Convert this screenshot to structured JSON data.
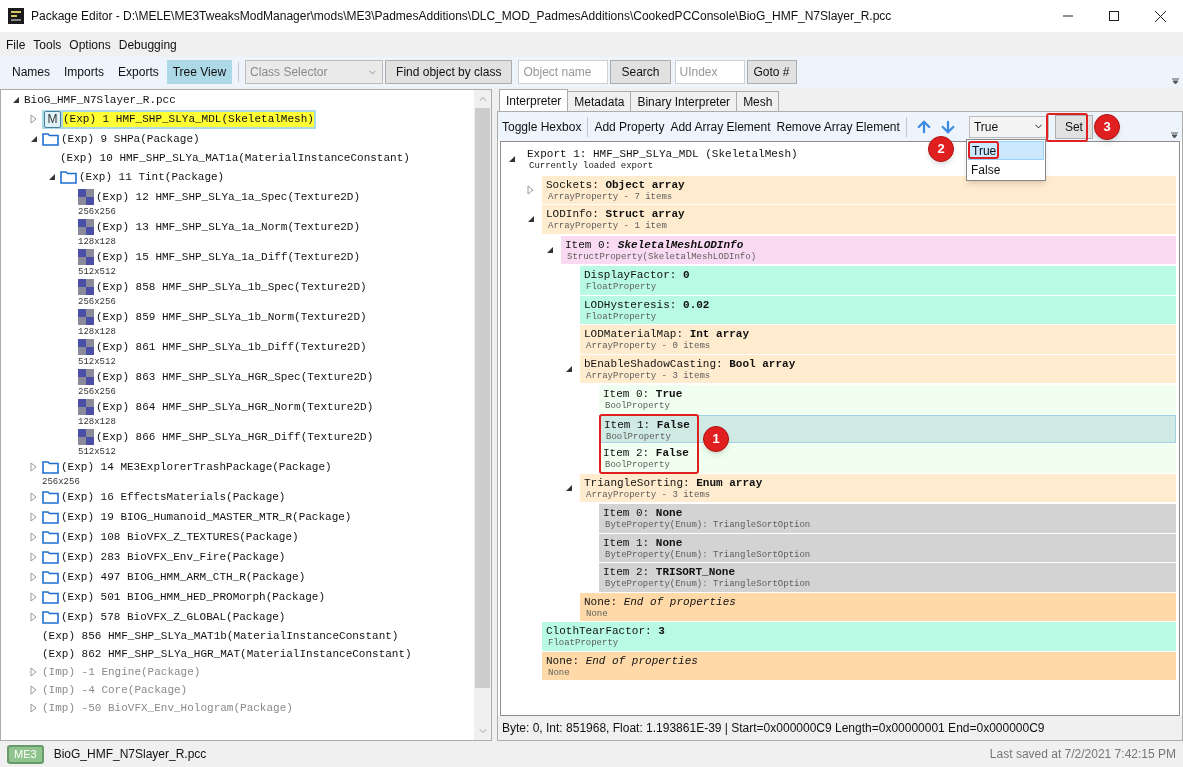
{
  "window": {
    "title": "Package Editor - D:\\MELE\\ME3TweaksModManager\\mods\\ME3\\PadmesAdditions\\DLC_MOD_PadmesAdditions\\CookedPCConsole\\BioG_HMF_N7Slayer_R.pcc"
  },
  "menu": [
    "File",
    "Tools",
    "Options",
    "Debugging"
  ],
  "view_buttons": [
    {
      "label": "Names",
      "selected": false
    },
    {
      "label": "Imports",
      "selected": false
    },
    {
      "label": "Exports",
      "selected": false
    },
    {
      "label": "Tree View",
      "selected": true
    }
  ],
  "class_selector": {
    "placeholder": "Class Selector",
    "disabled": true
  },
  "find_button": "Find object by class",
  "object_name": {
    "placeholder": "Object name"
  },
  "search_button": "Search",
  "uindex": {
    "placeholder": "UIndex"
  },
  "goto_button": "Goto #",
  "tree": {
    "text": "BioG_HMF_N7Slayer_R.pcc",
    "expanded": true,
    "selected": false,
    "children": [
      {
        "kind": "mesh",
        "badge": "M",
        "text": "(Exp) 1 HMF_SHP_SLYa_MDL(SkeletalMesh)",
        "expanded": false,
        "selected": true,
        "imported": false
      },
      {
        "kind": "folder",
        "text": "(Exp) 9 SHPa(Package)",
        "expanded": true,
        "selected": false,
        "imported": false,
        "children": [
          {
            "kind": "plain",
            "text": "(Exp) 10 HMF_SHP_SLYa_MAT1a(MaterialInstanceConstant)",
            "selected": false
          },
          {
            "kind": "folder",
            "text": "(Exp) 11 Tint(Package)",
            "expanded": true,
            "selected": false,
            "children": [
              {
                "kind": "texture",
                "text": "(Exp) 12 HMF_SHP_SLYa_1a_Spec(Texture2D)",
                "dims": "256x256",
                "selected": false
              },
              {
                "kind": "texture",
                "text": "(Exp) 13 HMF_SHP_SLYa_1a_Norm(Texture2D)",
                "dims": "128x128",
                "selected": false
              },
              {
                "kind": "texture",
                "text": "(Exp) 15 HMF_SHP_SLYa_1a_Diff(Texture2D)",
                "dims": "512x512",
                "selected": false
              },
              {
                "kind": "texture",
                "text": "(Exp) 858 HMF_SHP_SLYa_1b_Spec(Texture2D)",
                "dims": "256x256",
                "selected": false
              },
              {
                "kind": "texture",
                "text": "(Exp) 859 HMF_SHP_SLYa_1b_Norm(Texture2D)",
                "dims": "128x128",
                "selected": false
              },
              {
                "kind": "texture",
                "text": "(Exp) 861 HMF_SHP_SLYa_1b_Diff(Texture2D)",
                "dims": "512x512",
                "selected": false
              },
              {
                "kind": "texture",
                "text": "(Exp) 863 HMF_SHP_SLYa_HGR_Spec(Texture2D)",
                "dims": "256x256",
                "selected": false
              },
              {
                "kind": "texture",
                "text": "(Exp) 864 HMF_SHP_SLYa_HGR_Norm(Texture2D)",
                "dims": "128x128",
                "selected": false
              },
              {
                "kind": "texture",
                "text": "(Exp) 866 HMF_SHP_SLYa_HGR_Diff(Texture2D)",
                "dims": "512x512",
                "selected": false
              }
            ]
          }
        ]
      },
      {
        "kind": "folder",
        "text": "(Exp) 14 ME3ExplorerTrashPackage(Package)",
        "dims": "256x256",
        "expanded": false,
        "selected": false,
        "imported": false
      },
      {
        "kind": "folder",
        "text": "(Exp) 16 EffectsMaterials(Package)",
        "expanded": false,
        "selected": false,
        "imported": false
      },
      {
        "kind": "folder",
        "text": "(Exp) 19 BIOG_Humanoid_MASTER_MTR_R(Package)",
        "expanded": false,
        "selected": false,
        "imported": false
      },
      {
        "kind": "folder",
        "text": "(Exp) 108 BioVFX_Z_TEXTURES(Package)",
        "expanded": false,
        "selected": false,
        "imported": false
      },
      {
        "kind": "folder",
        "text": "(Exp) 283 BioVFX_Env_Fire(Package)",
        "expanded": false,
        "selected": false,
        "imported": false
      },
      {
        "kind": "folder",
        "text": "(Exp) 497 BIOG_HMM_ARM_CTH_R(Package)",
        "expanded": false,
        "selected": false,
        "imported": false
      },
      {
        "kind": "folder",
        "text": "(Exp) 501 BIOG_HMM_HED_PROMorph(Package)",
        "expanded": false,
        "selected": false,
        "imported": false
      },
      {
        "kind": "folder",
        "text": "(Exp) 578 BioVFX_Z_GLOBAL(Package)",
        "expanded": false,
        "selected": false,
        "imported": false
      },
      {
        "kind": "plain",
        "text": "(Exp) 856 HMF_SHP_SLYa_MAT1b(MaterialInstanceConstant)",
        "selected": false,
        "imported": false
      },
      {
        "kind": "plain",
        "text": "(Exp) 862 HMF_SHP_SLYa_HGR_MAT(MaterialInstanceConstant)",
        "selected": false,
        "imported": false
      },
      {
        "kind": "plain",
        "text": "(Imp) -1 Engine(Package)",
        "expanded": false,
        "selected": false,
        "imported": true
      },
      {
        "kind": "plain",
        "text": "(Imp) -4 Core(Package)",
        "expanded": false,
        "selected": false,
        "imported": true
      },
      {
        "kind": "plain",
        "text": "(Imp) -50 BioVFX_Env_Hologram(Package)",
        "expanded": false,
        "selected": false,
        "imported": true
      }
    ]
  },
  "tabs": [
    {
      "label": "Interpreter",
      "selected": true
    },
    {
      "label": "Metadata",
      "selected": false
    },
    {
      "label": "Binary Interpreter",
      "selected": false
    },
    {
      "label": "Mesh",
      "selected": false
    }
  ],
  "interpreter_toolbar": {
    "buttons": [
      "Toggle Hexbox",
      "Add Property",
      "Add Array Element",
      "Remove Array Element"
    ],
    "value": "True",
    "options": [
      {
        "label": "True",
        "selected": true
      },
      {
        "label": "False",
        "selected": false
      }
    ],
    "set_button": "Set"
  },
  "properties": {
    "kind": "export",
    "name": "Export 1: HMF_SHP_SLYa_MDL (SkeletalMesh)",
    "type": "Currently loaded export",
    "expanded": true,
    "selected": false,
    "children": [
      {
        "kind": "array",
        "name": "Sockets:",
        "value": "Object array",
        "type": "ArrayProperty - 7 items",
        "expanded": false,
        "selected": false
      },
      {
        "kind": "array",
        "name": "LODInfo:",
        "value": "Struct array",
        "type": "ArrayProperty - 1 item",
        "expanded": true,
        "selected": false,
        "children": [
          {
            "kind": "struct",
            "name": "Item 0:",
            "value": "SkeletalMeshLODInfo",
            "type": "StructProperty(SkeletalMeshLODInfo)",
            "expanded": true,
            "selected": false,
            "children": [
              {
                "kind": "float",
                "name": "DisplayFactor:",
                "value": "0",
                "type": "FloatProperty",
                "selected": false
              },
              {
                "kind": "float",
                "name": "LODHysteresis:",
                "value": "0.02",
                "type": "FloatProperty",
                "selected": false
              },
              {
                "kind": "array",
                "name": "LODMaterialMap:",
                "value": "Int array",
                "type": "ArrayProperty - 0 items",
                "selected": false
              },
              {
                "kind": "array",
                "name": "bEnableShadowCasting:",
                "value": "Bool array",
                "type": "ArrayProperty - 3 items",
                "expanded": true,
                "selected": false,
                "children": [
                  {
                    "kind": "bool",
                    "name": "Item 0:",
                    "value": "True",
                    "type": "BoolProperty",
                    "selected": false
                  },
                  {
                    "kind": "bool",
                    "name": "Item 1:",
                    "value": "False",
                    "type": "BoolProperty",
                    "selected": true
                  },
                  {
                    "kind": "bool",
                    "name": "Item 2:",
                    "value": "False",
                    "type": "BoolProperty",
                    "selected": false
                  }
                ]
              },
              {
                "kind": "array",
                "name": "TriangleSorting:",
                "value": "Enum array",
                "type": "ArrayProperty - 3 items",
                "expanded": true,
                "selected": false,
                "children": [
                  {
                    "kind": "enum",
                    "name": "Item 0:",
                    "value": "None",
                    "type": "ByteProperty(Enum): TriangleSortOption",
                    "selected": false
                  },
                  {
                    "kind": "enum",
                    "name": "Item 1:",
                    "value": "None",
                    "type": "ByteProperty(Enum): TriangleSortOption",
                    "selected": false
                  },
                  {
                    "kind": "enum",
                    "name": "Item 2:",
                    "value": "TRISORT_None",
                    "type": "ByteProperty(Enum): TriangleSortOption",
                    "selected": false
                  }
                ]
              },
              {
                "kind": "none",
                "name": "None:",
                "value": "End of properties",
                "type": "None",
                "selected": false
              }
            ]
          }
        ]
      },
      {
        "kind": "float",
        "name": "ClothTearFactor:",
        "value": "3",
        "type": "FloatProperty",
        "selected": false
      },
      {
        "kind": "none",
        "name": "None:",
        "value": "End of properties",
        "type": "None",
        "selected": false
      }
    ]
  },
  "info_bar": "Byte: 0, Int: 851968, Float: 1.193861E-39 | Start=0x000000C9 Length=0x00000001 End=0x000000C9",
  "callouts": [
    "1",
    "2",
    "3"
  ],
  "status_bar": {
    "game_badge": "ME3",
    "file": "BioG_HMF_N7Slayer_R.pcc",
    "last_saved": "Last saved at 7/2/2021 7:42:15 PM"
  }
}
